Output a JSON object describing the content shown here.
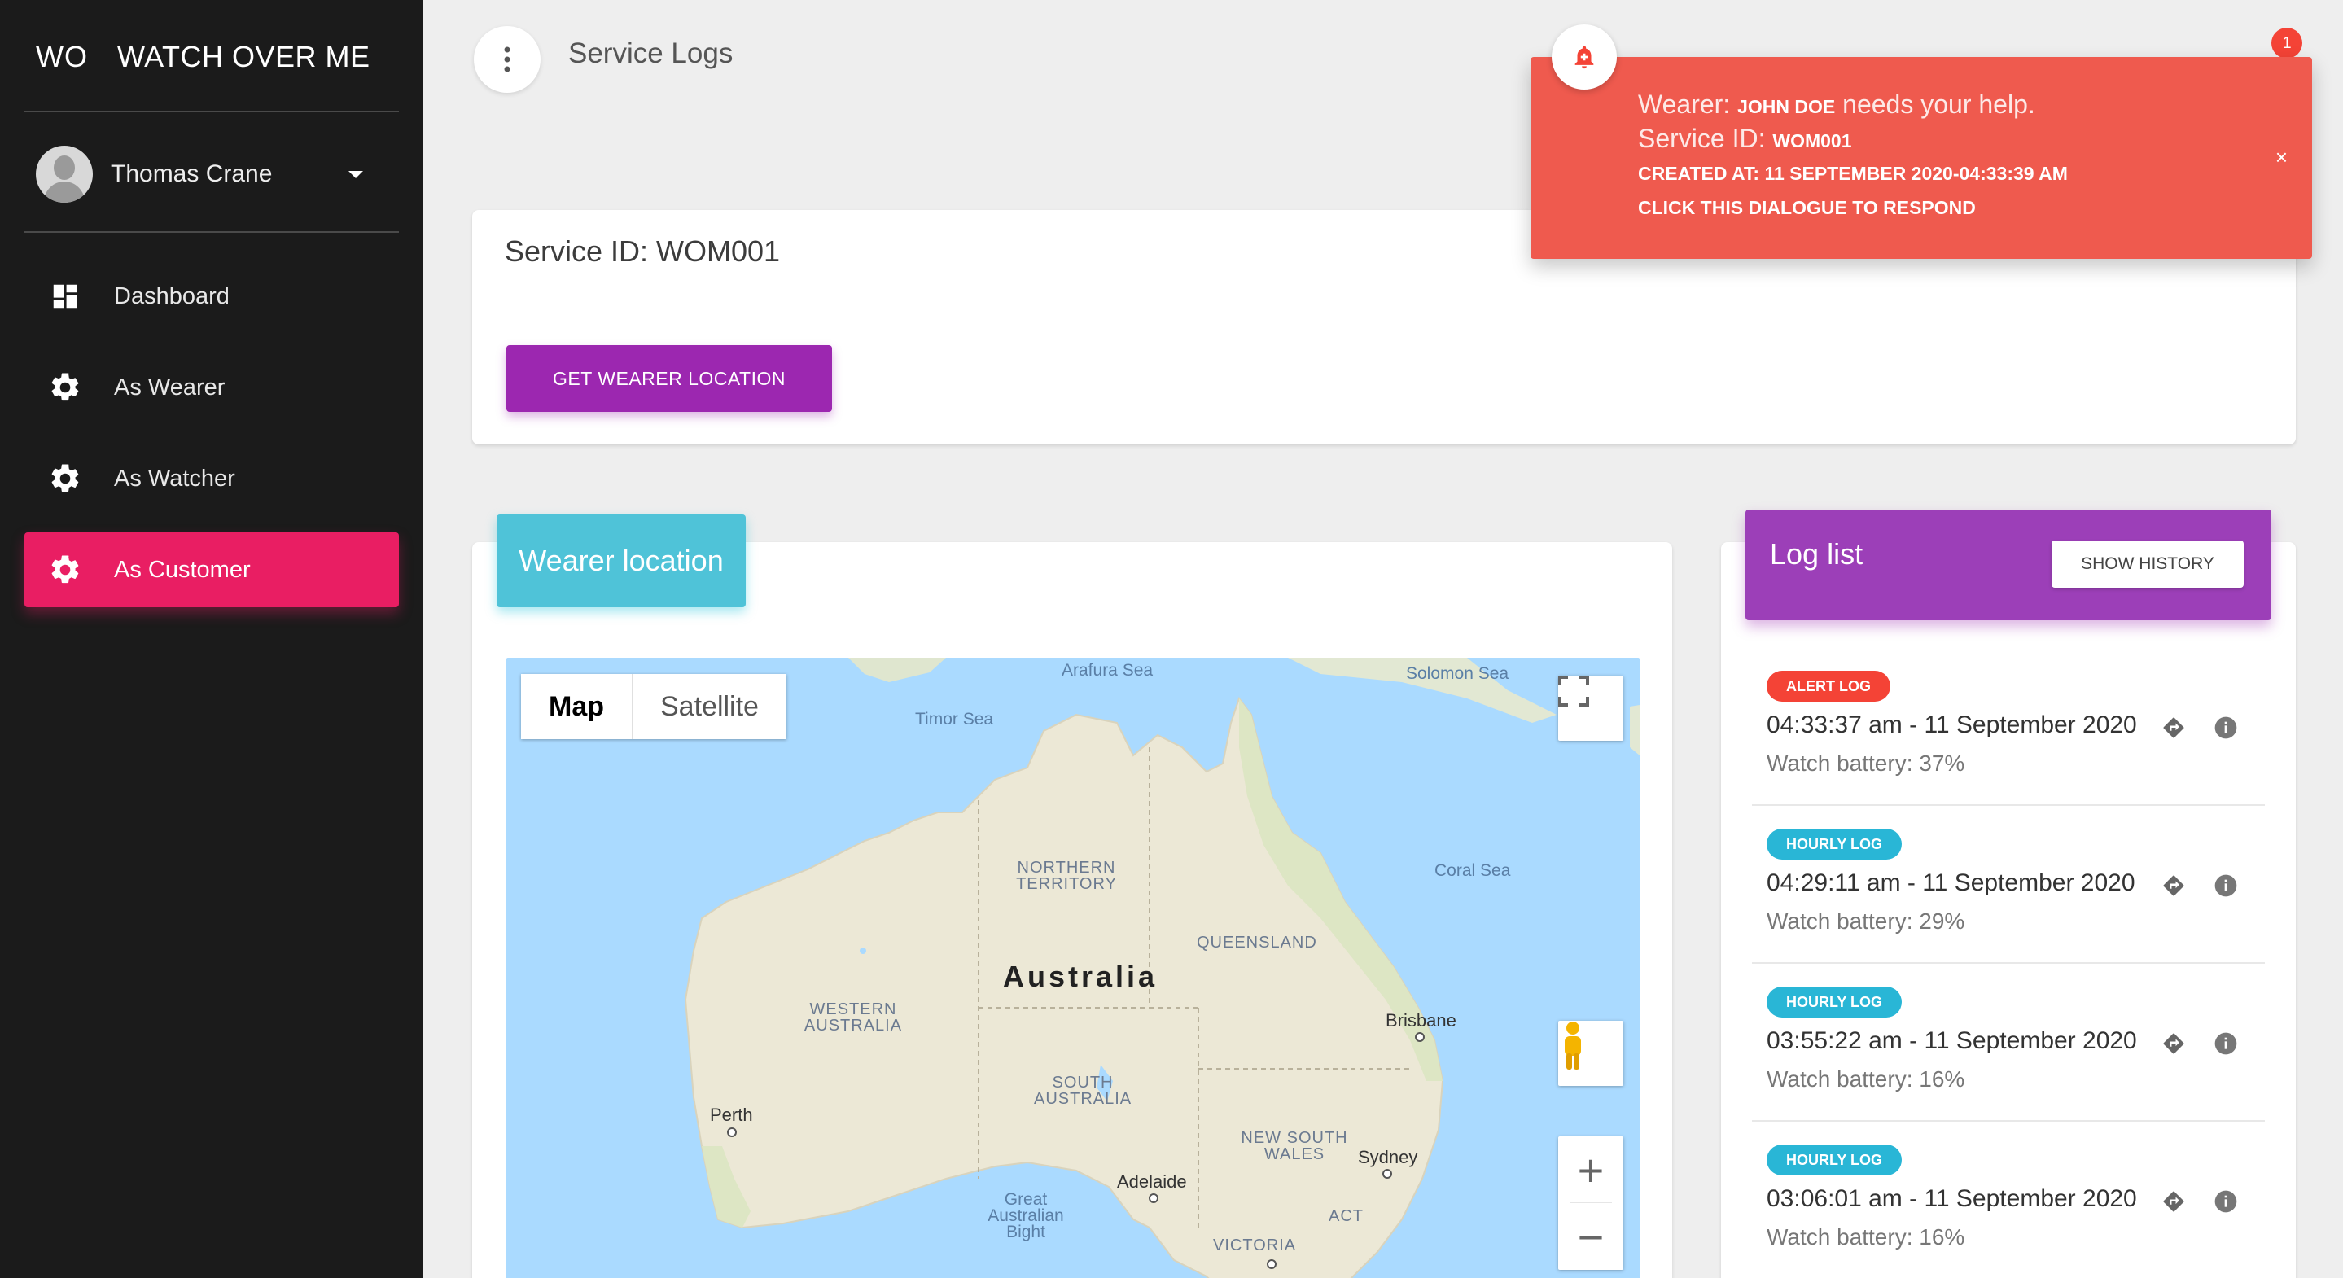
{
  "sidebar": {
    "brand_mini": "WO",
    "brand_full": "WATCH OVER ME",
    "user_name": "Thomas Crane",
    "items": [
      {
        "label": "Dashboard",
        "icon": "dashboard-icon"
      },
      {
        "label": "As Wearer",
        "icon": "gear-icon"
      },
      {
        "label": "As Watcher",
        "icon": "gear-icon"
      },
      {
        "label": "As Customer",
        "icon": "gear-icon",
        "active": true
      }
    ]
  },
  "topbar": {
    "title": "Service Logs",
    "notification_count": "1"
  },
  "service": {
    "title": "Service ID: WOM001",
    "button_label": "GET WEARER LOCATION"
  },
  "map_card": {
    "title": "Wearer location",
    "map_type_map": "Map",
    "map_type_satellite": "Satellite",
    "zoom_in": "+",
    "zoom_out": "−",
    "labels": {
      "arafura_sea": "Arafura Sea",
      "solomon_sea": "Solomon Sea",
      "timor_sea": "Timor Sea",
      "coral_sea": "Coral Sea",
      "northern_territory_1": "NORTHERN",
      "northern_territory_2": "TERRITORY",
      "queensland": "QUEENSLAND",
      "australia": "Australia",
      "western_australia_1": "WESTERN",
      "western_australia_2": "AUSTRALIA",
      "brisbane": "Brisbane",
      "perth": "Perth",
      "south_australia_1": "SOUTH",
      "south_australia_2": "AUSTRALIA",
      "new_south_wales_1": "NEW SOUTH",
      "new_south_wales_2": "WALES",
      "sydney": "Sydney",
      "adelaide": "Adelaide",
      "gab_1": "Great",
      "gab_2": "Australian",
      "gab_3": "Bight",
      "act": "ACT",
      "victoria": "VICTORIA"
    }
  },
  "log_list": {
    "title": "Log list",
    "history_button": "SHOW HISTORY",
    "entries": [
      {
        "type": "ALERT LOG",
        "kind": "alert",
        "time": "04:33:37 am - 11 September 2020",
        "battery": "Watch battery: 37%"
      },
      {
        "type": "HOURLY LOG",
        "kind": "hourly",
        "time": "04:29:11 am - 11 September 2020",
        "battery": "Watch battery: 29%"
      },
      {
        "type": "HOURLY LOG",
        "kind": "hourly",
        "time": "03:55:22 am - 11 September 2020",
        "battery": "Watch battery: 16%"
      },
      {
        "type": "HOURLY LOG",
        "kind": "hourly",
        "time": "03:06:01 am - 11 September 2020",
        "battery": "Watch battery: 16%"
      }
    ]
  },
  "alert_toast": {
    "wearer_prefix": "Wearer:",
    "wearer_name": "JOHN DOE",
    "wearer_suffix": "needs your help.",
    "service_prefix": "Service ID:",
    "service_id": "WOM001",
    "created_at": "CREATED AT: 11 SEPTEMBER 2020-04:33:39 AM",
    "cta": "CLICK THIS DIALOGUE TO RESPOND",
    "close": "×"
  },
  "colors": {
    "sidebar_bg": "#1b1b1b",
    "active_nav": "#e91e63",
    "primary_purple": "#9c27b0",
    "map_header": "#4fc3d8",
    "alert_badge": "#f44336",
    "hourly_badge": "#29b6d6",
    "toast_bg": "#ef5a4e"
  }
}
